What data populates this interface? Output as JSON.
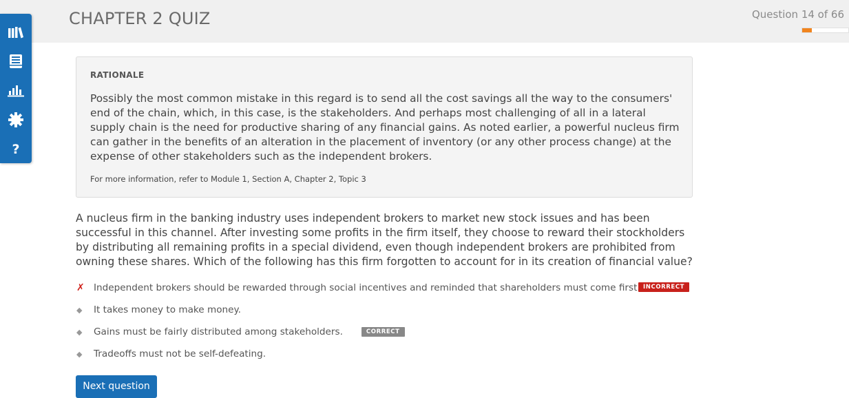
{
  "header": {
    "title": "CHAPTER 2 QUIZ",
    "question_counter": "Question 14 of 66",
    "progress_fraction": 0.212
  },
  "sidebar": {
    "items": [
      {
        "icon": "library-icon"
      },
      {
        "icon": "notes-icon"
      },
      {
        "icon": "stats-icon"
      },
      {
        "icon": "settings-icon"
      },
      {
        "icon": "help-icon",
        "label": "?"
      }
    ]
  },
  "rationale": {
    "heading": "RATIONALE",
    "body": "Possibly the most common mistake in this regard is to send all the cost savings all the way to the consumers' end of the chain, which, in this case, is the stakeholders. And perhaps most challenging of all in a lateral supply chain is the need for productive sharing of any financial gains. As noted earlier, a powerful nucleus firm can gather in the benefits of an alteration in the placement of inventory (or any other process change) at the expense of other stakeholders such as the independent brokers.",
    "reference": "For more information, refer to Module 1, Section A, Chapter 2, Topic 3"
  },
  "question": {
    "text": "A nucleus firm in the banking industry uses independent brokers to market new stock issues and has been successful in this channel. After investing some profits in the firm itself, they choose to reward their stockholders by distributing all remaining profits in a special dividend, even though independent brokers are prohibited from owning these shares. Which of the following has this firm forgotten to account for in its creation of financial value?"
  },
  "answers": [
    {
      "text": "Independent brokers should be rewarded through social incentives and reminded that shareholders must come first.",
      "marker": "✗",
      "badge": "INCORRECT"
    },
    {
      "text": "It takes money to make money.",
      "marker": "◆"
    },
    {
      "text": "Gains must be fairly distributed among stakeholders.",
      "marker": "◆",
      "badge": "CORRECT"
    },
    {
      "text": "Tradeoffs must not be self-defeating.",
      "marker": "◆"
    }
  ],
  "next_button": {
    "label": "Next question"
  },
  "colors": {
    "accent": "#1a6fb6",
    "progress": "#f0841e",
    "incorrect": "#c8211b",
    "correct": "#888888"
  }
}
